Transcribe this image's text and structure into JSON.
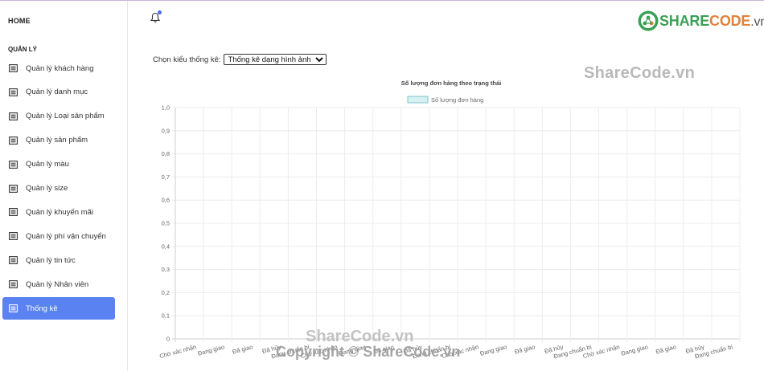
{
  "sidebar": {
    "home": "HOME",
    "section": "QUẢN LÝ",
    "items": [
      {
        "label": "Quản lý khách hàng",
        "name": "sidebar-item-khach-hang"
      },
      {
        "label": "Quản lý danh mục",
        "name": "sidebar-item-danh-muc"
      },
      {
        "label": "Quản lý Loại sản phẩm",
        "name": "sidebar-item-loai-san-pham"
      },
      {
        "label": "Quản lý sản phẩm",
        "name": "sidebar-item-san-pham"
      },
      {
        "label": "Quản lý màu",
        "name": "sidebar-item-mau"
      },
      {
        "label": "Quản lý size",
        "name": "sidebar-item-size"
      },
      {
        "label": "Quản lý khuyến mãi",
        "name": "sidebar-item-khuyen-mai"
      },
      {
        "label": "Quản lý phí vận chuyển",
        "name": "sidebar-item-phi-van-chuyen"
      },
      {
        "label": "Quản lý tin tức",
        "name": "sidebar-item-tin-tuc"
      },
      {
        "label": "Quản lý Nhân viên",
        "name": "sidebar-item-nhan-vien"
      },
      {
        "label": "Thống kê",
        "name": "sidebar-item-thong-ke",
        "active": true
      }
    ]
  },
  "header": {
    "notification_icon": "bell-icon",
    "logo": {
      "part1": "SHARE",
      "part2": "CODE",
      "part3": ".vn"
    }
  },
  "filter": {
    "label": "Chọn kiểu thống kê:",
    "selected": "Thống kê dạng hình ảnh"
  },
  "watermarks": {
    "top": "ShareCode.vn",
    "bottom": "ShareCode.vn",
    "copyright": "Copyright © ShareCode.vn"
  },
  "colors": {
    "accent": "#5a82f0",
    "bar_fill": "#d7f0f2",
    "bar_border": "#7cc6cf"
  },
  "chart_data": {
    "type": "bar",
    "title": "Số lượng đơn hàng theo trạng thái",
    "legend": [
      "Số lượng đơn hàng"
    ],
    "legend_position": "top",
    "ylim": [
      0,
      1
    ],
    "yticks": [
      "0",
      "0,1",
      "0,2",
      "0,3",
      "0,4",
      "0,5",
      "0,6",
      "0,7",
      "0,8",
      "0,9",
      "1,0"
    ],
    "grid": true,
    "categories": [
      "Chờ xác nhận",
      "Đang giao",
      "Đã giao",
      "Đã hủy",
      "Đang chuẩn bị",
      "Chờ xác nhận",
      "Đang giao",
      "Đã giao",
      "Đã hủy",
      "Đang chuẩn bị",
      "Chờ xác nhận",
      "Đang giao",
      "Đã giao",
      "Đã hủy",
      "Đang chuẩn bị",
      "Chờ xác nhận",
      "Đang giao",
      "Đã giao",
      "Đã hủy",
      "Đang chuẩn bị"
    ],
    "series": [
      {
        "name": "Số lượng đơn hàng",
        "values": [
          0,
          0,
          0,
          0,
          0,
          0,
          0,
          0,
          0,
          0,
          0,
          0,
          0,
          0,
          0,
          0,
          0,
          0,
          0,
          0
        ]
      }
    ]
  }
}
